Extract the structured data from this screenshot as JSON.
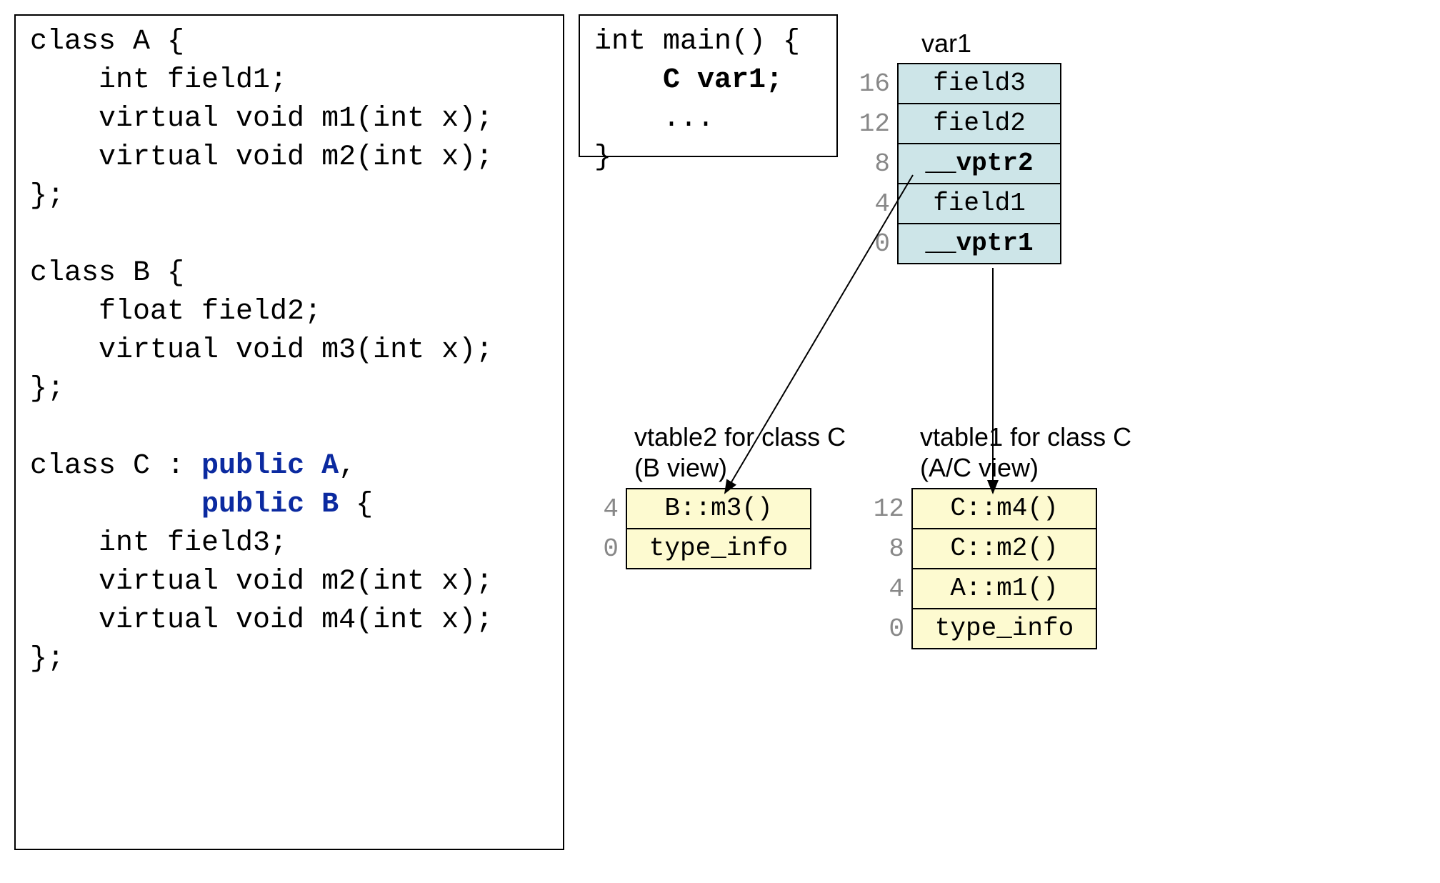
{
  "code_left": {
    "lines": [
      {
        "t": "class A {"
      },
      {
        "t": "    int field1;"
      },
      {
        "t": "    virtual void m1(int x);"
      },
      {
        "t": "    virtual void m2(int x);"
      },
      {
        "t": "};"
      },
      {
        "t": ""
      },
      {
        "t": "class B {"
      },
      {
        "t": "    float field2;"
      },
      {
        "t": "    virtual void m3(int x);"
      },
      {
        "t": "};"
      },
      {
        "t": ""
      },
      {
        "pre": "class C : ",
        "kw1": "public A",
        "mid": ","
      },
      {
        "pre": "          ",
        "kw1": "public B",
        "mid": " {"
      },
      {
        "t": "    int field3;"
      },
      {
        "t": "    virtual void m2(int x);"
      },
      {
        "t": "    virtual void m4(int x);"
      },
      {
        "t": "};"
      }
    ]
  },
  "code_right": {
    "l1": "int main() {",
    "l2_pre": "    ",
    "l2_bold": "C var1;",
    "l3": "    ...",
    "l4": "}"
  },
  "var1": {
    "label": "var1",
    "rows": [
      {
        "offset": "16",
        "name": "field3",
        "bold": false
      },
      {
        "offset": "12",
        "name": "field2",
        "bold": false
      },
      {
        "offset": "8",
        "name": "__vptr2",
        "bold": true
      },
      {
        "offset": "4",
        "name": "field1",
        "bold": false
      },
      {
        "offset": "0",
        "name": "__vptr1",
        "bold": true
      }
    ]
  },
  "vtable2": {
    "title1": "vtable2 for class C",
    "title2": "(B view)",
    "rows": [
      {
        "offset": "4",
        "name": "B::m3()"
      },
      {
        "offset": "0",
        "name": "type_info"
      }
    ]
  },
  "vtable1": {
    "title1": "vtable1 for class C",
    "title2": "(A/C view)",
    "rows": [
      {
        "offset": "12",
        "name": "C::m4()"
      },
      {
        "offset": "8",
        "name": "C::m2()"
      },
      {
        "offset": "4",
        "name": "A::m1()"
      },
      {
        "offset": "0",
        "name": "type_info"
      }
    ]
  }
}
